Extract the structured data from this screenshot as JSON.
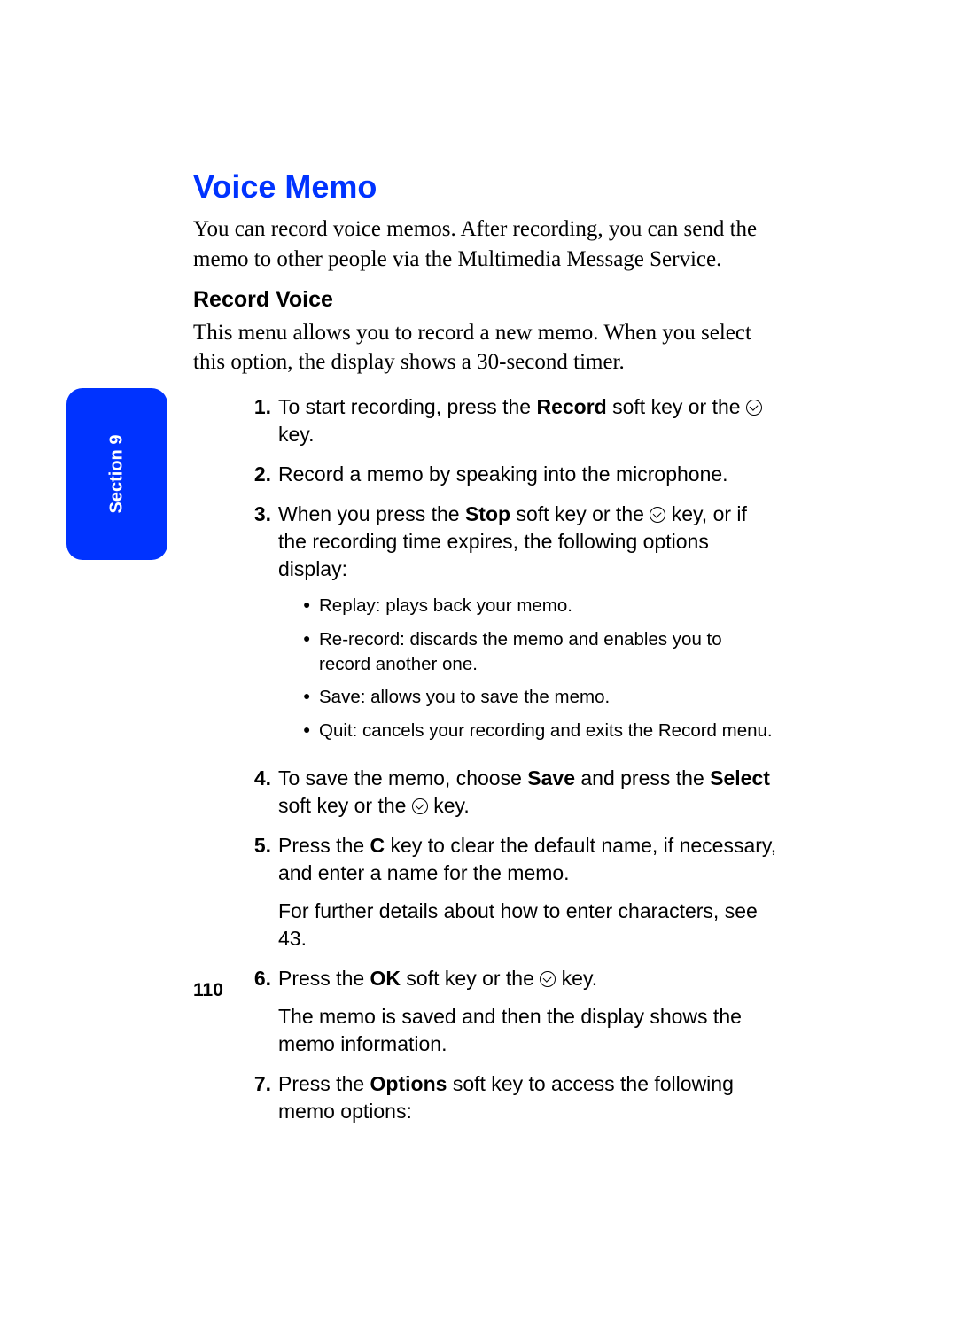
{
  "sidebar": {
    "label": "Section 9"
  },
  "heading1": "Voice Memo",
  "intro": "You can record voice memos. After recording, you can send the memo to other people via the Multimedia Message Service.",
  "heading2": "Record Voice",
  "desc": "This menu allows you to record a new memo. When you select this option, the display shows a 30-second timer.",
  "steps": {
    "s1": {
      "num": "1.",
      "pre": "To start recording, press the ",
      "bold1": "Record",
      "mid": " soft key or the ",
      "post": " key."
    },
    "s2": {
      "num": "2.",
      "text": "Record a memo by speaking into the microphone."
    },
    "s3": {
      "num": "3.",
      "pre": "When you press the ",
      "bold1": "Stop",
      "mid": " soft key or the ",
      "post": " key, or if the recording time expires, the following options display:",
      "sub": {
        "a": "Replay: plays back your memo.",
        "b": "Re-record: discards the memo and enables you to record another one.",
        "c": "Save: allows you to save the memo.",
        "d": "Quit: cancels your recording and exits the Record menu."
      }
    },
    "s4": {
      "num": "4.",
      "pre": "To save the memo, choose ",
      "bold1": "Save",
      "mid": " and press the ",
      "bold2": "Select",
      "mid2": " soft key or the ",
      "post": " key."
    },
    "s5": {
      "num": "5.",
      "pre": "Press the ",
      "bold1": "C",
      "post": " key to clear the default name, if necessary, and enter a name for the memo.",
      "para2": "For further details about how to enter characters, see 43."
    },
    "s6": {
      "num": "6.",
      "pre": "Press the ",
      "bold1": "OK",
      "mid": " soft key or the ",
      "post": " key.",
      "para2": "The memo is saved and then the display shows the memo information."
    },
    "s7": {
      "num": "7.",
      "pre": "Press the ",
      "bold1": "Options",
      "post": " soft key to access the following memo options:"
    }
  },
  "page_number": "110"
}
